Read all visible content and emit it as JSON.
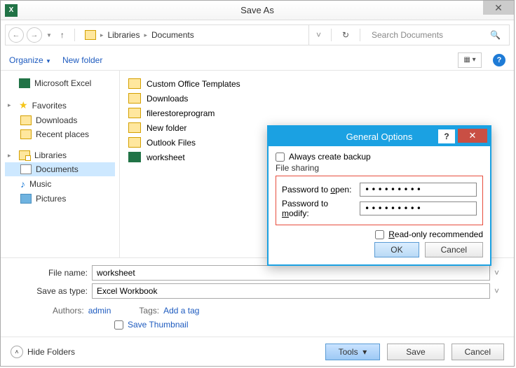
{
  "window": {
    "title": "Save As"
  },
  "nav": {
    "crumbs": [
      "Libraries",
      "Documents"
    ],
    "searchPlaceholder": "Search Documents"
  },
  "toolbar": {
    "organize": "Organize",
    "newFolder": "New folder"
  },
  "tree": {
    "excel": "Microsoft Excel",
    "favorites": "Favorites",
    "downloads": "Downloads",
    "recent": "Recent places",
    "libraries": "Libraries",
    "documents": "Documents",
    "music": "Music",
    "pictures": "Pictures"
  },
  "files": {
    "items": [
      {
        "name": "Custom Office Templates",
        "type": "folder"
      },
      {
        "name": "Downloads",
        "type": "folder"
      },
      {
        "name": "filerestoreprogram",
        "type": "folder"
      },
      {
        "name": "New folder",
        "type": "folder"
      },
      {
        "name": "Outlook Files",
        "type": "folder"
      },
      {
        "name": "worksheet",
        "type": "xls"
      }
    ]
  },
  "form": {
    "fileNameLabel": "File name:",
    "fileName": "worksheet",
    "typeLabel": "Save as type:",
    "type": "Excel Workbook",
    "authorsLabel": "Authors:",
    "authors": "admin",
    "tagsLabel": "Tags:",
    "tags": "Add a tag",
    "saveThumb": "Save Thumbnail"
  },
  "footer": {
    "hideFolders": "Hide Folders",
    "tools": "Tools",
    "save": "Save",
    "cancel": "Cancel"
  },
  "modal": {
    "title": "General Options",
    "backup": "Always create backup",
    "fileSharing": "File sharing",
    "pwdOpenLabelPre": "Password to ",
    "pwdOpenU": "o",
    "pwdOpenLabelPost": "pen:",
    "pwdModifyLabelPre": "Password to ",
    "pwdModifyU": "m",
    "pwdModifyLabelPost": "odify:",
    "pwdOpen": "•••••••••",
    "pwdModify": "•••••••••",
    "readOnlyPre": "",
    "readOnlyU": "R",
    "readOnlyPost": "ead-only recommended",
    "ok": "OK",
    "cancel": "Cancel"
  }
}
